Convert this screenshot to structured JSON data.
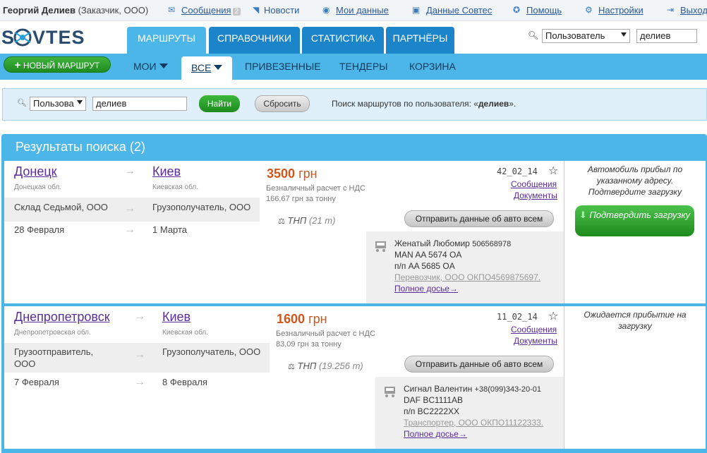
{
  "topbar": {
    "user_name": "Георгий Делиев",
    "user_role": "(Заказчик, ООО)",
    "messages": "Сообщения",
    "messages_count": "2",
    "news": "Новости",
    "my_data": "Мои данные",
    "sovtes_data": "Данные Совтес",
    "help": "Помощь",
    "settings": "Настройки",
    "logout": "Выход"
  },
  "header": {
    "logo": "SOVTES",
    "tabs": [
      "МАРШРУТЫ",
      "СПРАВОЧНИКИ",
      "СТАТИСТИКА",
      "ПАРТНЁРЫ"
    ],
    "search_select": "Пользователь",
    "search_value": "делиев"
  },
  "subnav": {
    "new_route": "НОВЫЙ МАРШРУТ",
    "items": [
      "МОИ",
      "ВСЕ",
      "ПРИВЕЗЕННЫЕ",
      "ТЕНДЕРЫ",
      "КОРЗИНА"
    ]
  },
  "search": {
    "select": "Пользова",
    "value": "делиев",
    "find": "Найти",
    "reset": "Сбросить",
    "summary_prefix": "Поиск маршрутов по пользователя: «",
    "summary_term": "делиев",
    "summary_suffix": "»."
  },
  "results": {
    "title": "Результаты поиска (2)",
    "routes": [
      {
        "from_city": "Донецк",
        "from_region": "Донецкая обл.",
        "to_city": "Киев",
        "to_region": "Киевская обл.",
        "sender": "Склад Седьмой, ООО",
        "receiver": "Грузополучатель, ООО",
        "date_from": "28 Февраля",
        "date_to": "1 Марта",
        "price": "3500",
        "currency": "грн",
        "payment": "Безналичный расчет с НДС",
        "per_ton": "166,67 грн за тонну",
        "cargo": "ТНП",
        "weight": "(21 т)",
        "number": "42_02_14",
        "messages": "Сообщения",
        "documents": "Документы",
        "send_btn": "Отправить данные об авто всем",
        "driver_name": "Женатый Любомир",
        "driver_phone": "506568978",
        "vehicle": "MAN AA 5674 OA",
        "trailer": "п/п AA 5685 OA",
        "carrier": "Перевозчик, ООО ОКПО4569875697.",
        "dossier": "Полное досье→",
        "status": "Автомобиль прибыл по указанному адресу. Подтвердите загрузку",
        "confirm": "Подтвердить загрузку"
      },
      {
        "from_city": "Днепропетровск",
        "from_region": "Днепропетровская обл.",
        "to_city": "Киев",
        "to_region": "Киевская обл.",
        "sender": "Грузоотправитель, ООО",
        "receiver": "Грузополучатель, ООО",
        "date_from": "7 Февраля",
        "date_to": "8 Февраля",
        "price": "1600",
        "currency": "грн",
        "payment": "Безналичный расчет с НДС",
        "per_ton": "83,09 грн за тонну",
        "cargo": "ТНП",
        "weight": "(19.256 т)",
        "number": "11_02_14",
        "messages": "Сообщения",
        "documents": "Документы",
        "send_btn": "Отправить данные об авто всем",
        "driver_name": "Сигнал Валентин",
        "driver_phone": "+38(099)343-20-01",
        "vehicle": "DAF BC1111AB",
        "trailer": "п/п BC2222XX",
        "carrier": "Транспортер, ООО ОКПО11122333.",
        "dossier": "Полное досье→",
        "status": "Ожидается прибытие на загрузку"
      }
    ]
  }
}
